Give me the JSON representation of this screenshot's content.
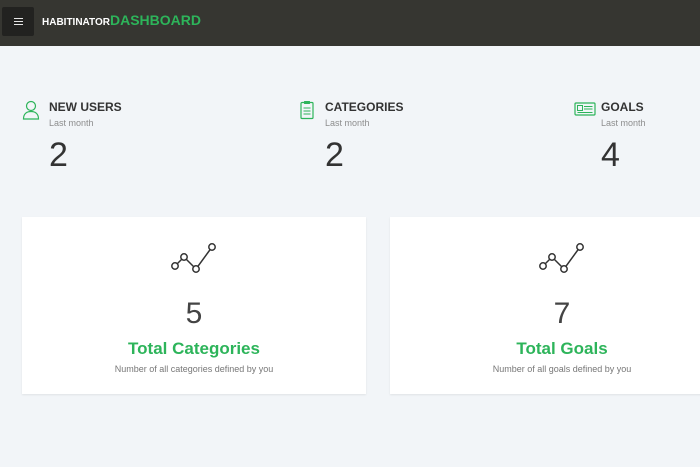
{
  "header": {
    "brand_prefix": "HABITINATOR",
    "brand_suffix": "DASHBOARD",
    "menu_icon": "hamburger-icon"
  },
  "stats": [
    {
      "title": "NEW USERS",
      "subtitle": "Last month",
      "value": "2",
      "icon": "user-icon"
    },
    {
      "title": "CATEGORIES",
      "subtitle": "Last month",
      "value": "2",
      "icon": "clipboard-icon"
    },
    {
      "title": "GOALS",
      "subtitle": "Last month",
      "value": "4",
      "icon": "ticket-icon"
    }
  ],
  "cards": [
    {
      "value": "5",
      "label": "Total Categories",
      "description": "Number of all categories defined by you",
      "icon": "line-chart-icon"
    },
    {
      "value": "7",
      "label": "Total Goals",
      "description": "Number of all goals defined by you",
      "icon": "line-chart-icon"
    }
  ],
  "colors": {
    "accent": "#2db45a",
    "topbar": "#363631",
    "background": "#f2f5f8"
  }
}
